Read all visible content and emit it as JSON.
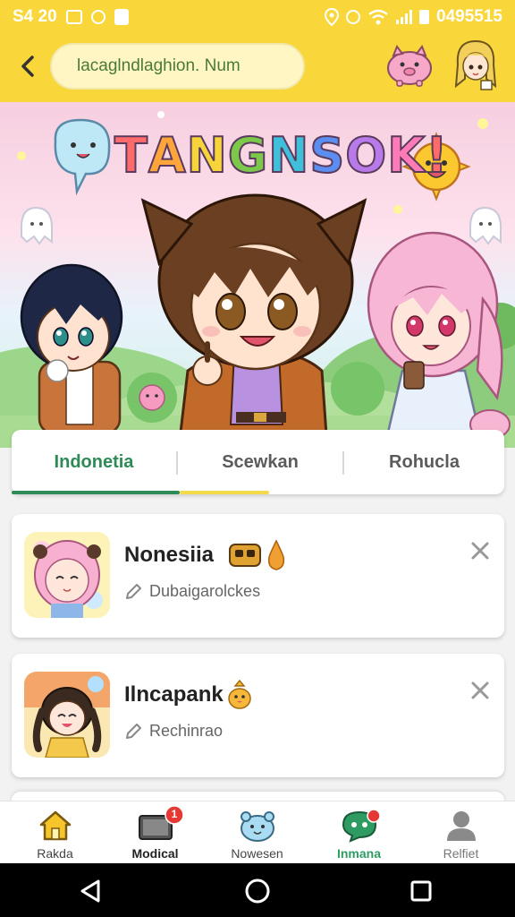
{
  "status_bar": {
    "time": "S4 20",
    "right_text": "0495515"
  },
  "header": {
    "search_text": "lacaglndlaghion. Num"
  },
  "banner": {
    "title": "TANGNSOK!",
    "title_colors": [
      "#ff6b6b",
      "#ffa53b",
      "#f6d43a",
      "#7cc84a",
      "#3fbfd9",
      "#5b8ef0",
      "#b77ae8",
      "#ff7ab6",
      "#ff6b6b"
    ]
  },
  "tabs": [
    {
      "label": "Indonetia",
      "active": true
    },
    {
      "label": "Scewkan",
      "active": false
    },
    {
      "label": "Rohucla",
      "active": false
    }
  ],
  "items": [
    {
      "title": "Nonesiia",
      "subtitle": "Dubaigarolckes",
      "emoji": "mask-and-flame"
    },
    {
      "title": "Ilncapank",
      "subtitle": "Rechinrao",
      "emoji": "chick"
    }
  ],
  "bottom_nav": [
    {
      "label": "Rakda",
      "icon": "home-icon"
    },
    {
      "label": "Modical",
      "icon": "tv-icon",
      "badge": "1"
    },
    {
      "label": "Nowesen",
      "icon": "creature-icon"
    },
    {
      "label": "Inmana",
      "icon": "chat-icon"
    },
    {
      "label": "Relfiet",
      "icon": "profile-icon"
    }
  ],
  "colors": {
    "accent_yellow": "#f9d73a",
    "active_green": "#2e8b57",
    "badge_red": "#e53935"
  }
}
